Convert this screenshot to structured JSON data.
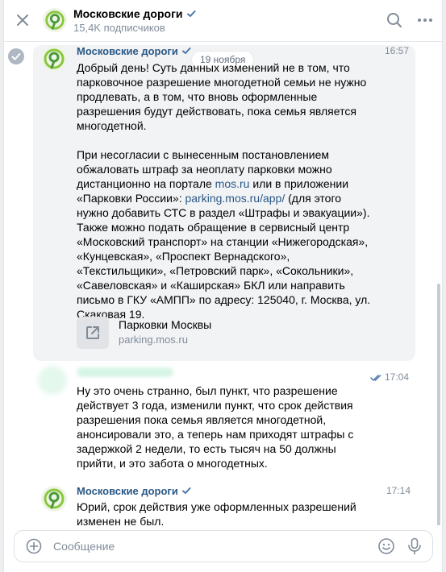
{
  "header": {
    "title": "Московские дороги",
    "subscribers": "15,4K подписчиков"
  },
  "date_chip": "19 ноября",
  "messages": [
    {
      "author": "Московские дороги",
      "time": "16:57",
      "text_part1": "Добрый день! Суть данных изменений не в том, что парковочное разрешение многодетной семьи не нужно продлевать, а в том, что вновь оформленные разрешения будут действовать, пока семья является многодетной.\n\nПри несогласии с вынесенным постановлением обжаловать штраф за неоплату парковки можно дистанционно на портале ",
      "link1": "mos.ru",
      "text_part2": " или в приложении «Парковки России»: ",
      "link2": "parking.mos.ru/app/",
      "text_part3": " (для этого нужно добавить СТС в раздел «Штрафы и эвакуации»). Также можно подать обращение в сервисный центр «Московский транспорт» на станции «Нижегородская», «Кунцевская», «Проспект Вернадского», «Текстильщики», «Петровский парк», «Сокольники», «Савеловская» и «Каширская» БКЛ или направить письмо в ГКУ «АМПП» по адресу: 125040, г. Москва, ул. Скаковая 19.",
      "link_card": {
        "title": "Парковки Москвы",
        "domain": "parking.mos.ru"
      }
    },
    {
      "time": "17:04",
      "text": "Ну это очень странно, был пункт, что разрешение действует 3 года, изменили пункт, что срок действия разрешения пока семья является многодетной, анонсировали это, а теперь нам приходят штрафы с задержкой 2 недели, то есть тысяч на 50 должны прийти, и это забота о многодетных."
    },
    {
      "author": "Московские дороги",
      "time": "17:14",
      "text": "Юрий, срок действия уже оформленных разрешений изменен не был."
    }
  ],
  "composer": {
    "placeholder": "Сообщение"
  },
  "colors": {
    "accent": "#2a5885",
    "logo_green": "#8cc63f",
    "logo_dark_green": "#4a9a3a",
    "muted": "#818c99"
  },
  "icons": [
    "close-icon",
    "search-icon",
    "more-icon",
    "verified-icon",
    "check-circle-icon",
    "external-link-icon",
    "double-check-icon",
    "attach-plus-icon",
    "emoji-icon",
    "mic-icon"
  ]
}
